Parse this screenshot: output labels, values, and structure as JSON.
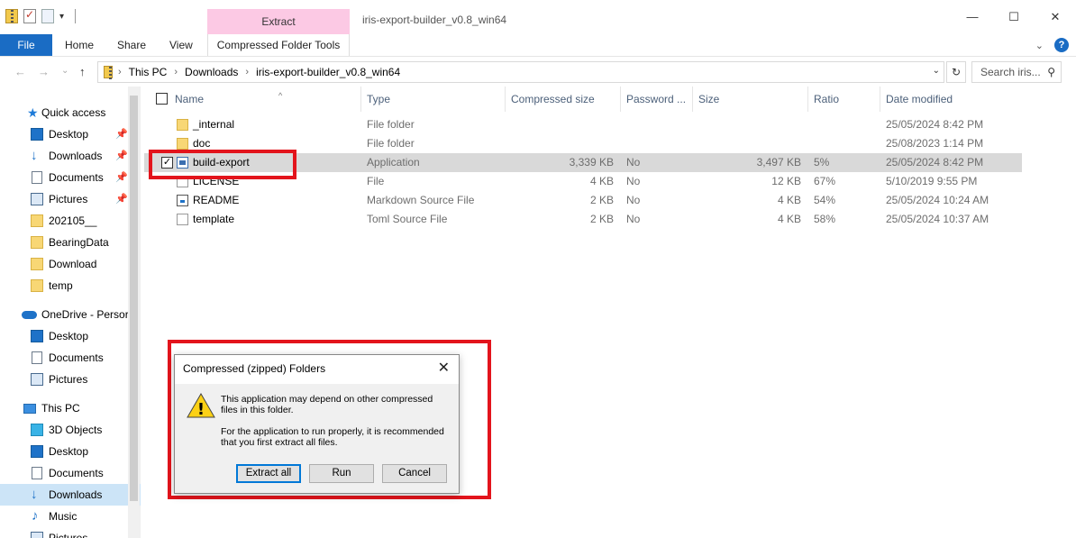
{
  "window": {
    "title": "iris-export-builder_v0.8_win64",
    "context_tab_group": "Extract",
    "controls": {
      "minimize": "—",
      "maximize": "☐",
      "close": "✕"
    }
  },
  "ribbon": {
    "tabs": [
      "File",
      "Home",
      "Share",
      "View",
      "Compressed Folder Tools"
    ],
    "active_tab": "Compressed Folder Tools",
    "collapse_glyph": "⌄",
    "help_glyph": "?"
  },
  "address": {
    "crumbs": [
      "This PC",
      "Downloads",
      "iris-export-builder_v0.8_win64"
    ],
    "search_placeholder": "Search iris...",
    "nav_glyphs": {
      "back": "←",
      "forward": "→",
      "recent": "⌄",
      "up": "↑",
      "refresh": "↻",
      "search": "⚲",
      "dropdown": "⌄"
    }
  },
  "nav_pane": {
    "items": [
      {
        "label": "Quick access",
        "icon": "star-icon",
        "pinned": false,
        "selected": false
      },
      {
        "label": "Desktop",
        "icon": "desktop-icon",
        "pinned": true,
        "selected": false
      },
      {
        "label": "Downloads",
        "icon": "downloads-icon",
        "pinned": true,
        "selected": false
      },
      {
        "label": "Documents",
        "icon": "documents-icon",
        "pinned": true,
        "selected": false
      },
      {
        "label": "Pictures",
        "icon": "pictures-icon",
        "pinned": true,
        "selected": false
      },
      {
        "label": "202105__",
        "icon": "folder-icon",
        "pinned": false,
        "selected": false
      },
      {
        "label": "BearingData",
        "icon": "folder-icon",
        "pinned": false,
        "selected": false
      },
      {
        "label": "Download",
        "icon": "folder-icon",
        "pinned": false,
        "selected": false
      },
      {
        "label": "temp",
        "icon": "folder-icon",
        "pinned": false,
        "selected": false
      },
      {
        "label": "OneDrive - Persor",
        "icon": "onedrive-icon",
        "pinned": false,
        "selected": false
      },
      {
        "label": "Desktop",
        "icon": "desktop-icon",
        "pinned": false,
        "selected": false
      },
      {
        "label": "Documents",
        "icon": "documents-icon",
        "pinned": false,
        "selected": false
      },
      {
        "label": "Pictures",
        "icon": "pictures-icon",
        "pinned": false,
        "selected": false
      },
      {
        "label": "This PC",
        "icon": "this-pc-icon",
        "pinned": false,
        "selected": false
      },
      {
        "label": "3D Objects",
        "icon": "3d-objects-icon",
        "pinned": false,
        "selected": false
      },
      {
        "label": "Desktop",
        "icon": "desktop-icon",
        "pinned": false,
        "selected": false
      },
      {
        "label": "Documents",
        "icon": "documents-icon",
        "pinned": false,
        "selected": false
      },
      {
        "label": "Downloads",
        "icon": "downloads-icon",
        "pinned": false,
        "selected": true
      },
      {
        "label": "Music",
        "icon": "music-icon",
        "pinned": false,
        "selected": false
      },
      {
        "label": "Pictures",
        "icon": "pictures-icon",
        "pinned": false,
        "selected": false
      }
    ],
    "pin_glyph": "📌"
  },
  "file_list": {
    "columns": [
      "Name",
      "Type",
      "Compressed size",
      "Password ...",
      "Size",
      "Ratio",
      "Date modified"
    ],
    "sort_glyph": "^",
    "rows": [
      {
        "name": "_internal",
        "icon": "folder-icon",
        "type": "File folder",
        "compressed": "",
        "password": "",
        "size": "",
        "ratio": "",
        "date": "25/05/2024 8:42 PM",
        "selected": false
      },
      {
        "name": "doc",
        "icon": "folder-icon",
        "type": "File folder",
        "compressed": "",
        "password": "",
        "size": "",
        "ratio": "",
        "date": "25/08/2023 1:14 PM",
        "selected": false
      },
      {
        "name": "build-export",
        "icon": "application-icon",
        "type": "Application",
        "compressed": "3,339 KB",
        "password": "No",
        "size": "3,497 KB",
        "ratio": "5%",
        "date": "25/05/2024 8:42 PM",
        "selected": true
      },
      {
        "name": "LICENSE",
        "icon": "file-icon",
        "type": "File",
        "compressed": "4 KB",
        "password": "No",
        "size": "12 KB",
        "ratio": "67%",
        "date": "5/10/2019 9:55 PM",
        "selected": false
      },
      {
        "name": "README",
        "icon": "markdown-file-icon",
        "type": "Markdown Source File",
        "compressed": "2 KB",
        "password": "No",
        "size": "4 KB",
        "ratio": "54%",
        "date": "25/05/2024 10:24 AM",
        "selected": false
      },
      {
        "name": "template",
        "icon": "toml-file-icon",
        "type": "Toml Source File",
        "compressed": "2 KB",
        "password": "No",
        "size": "4 KB",
        "ratio": "58%",
        "date": "25/05/2024 10:37 AM",
        "selected": false
      }
    ],
    "check_glyph": "✓"
  },
  "dialog": {
    "title": "Compressed (zipped) Folders",
    "close_glyph": "✕",
    "warning_glyph": "!",
    "message_1": "This application may depend on other compressed files in this folder.",
    "message_2": "For the application to run properly, it is recommended that you first extract all files.",
    "buttons": {
      "extract_all": "Extract all",
      "run": "Run",
      "cancel": "Cancel"
    }
  },
  "colors": {
    "highlight_red": "#e3141c",
    "file_tab_blue": "#1a6cc4",
    "extract_tab_pink": "#fcc9e4",
    "selection_grey": "#d9d9d9",
    "nav_selection": "#cce4f7"
  }
}
